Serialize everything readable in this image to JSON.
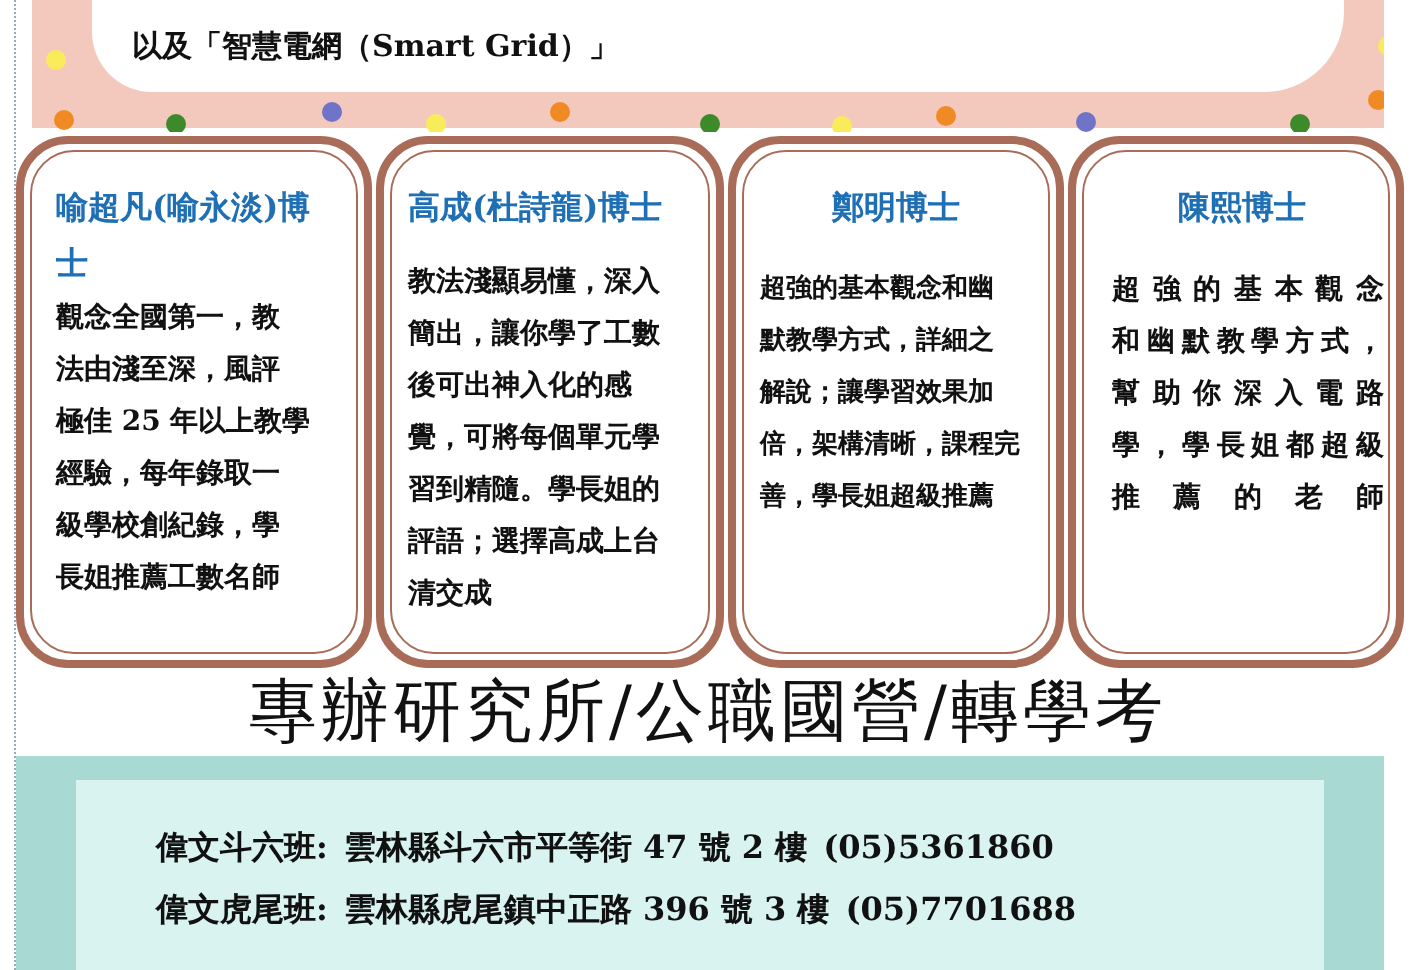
{
  "banner": {
    "text": "以及「智慧電網（Smart Grid）」"
  },
  "teachers": [
    {
      "name": "喻超凡(喻永淡)博士",
      "description": [
        "觀念全國第一，教",
        "法由淺至深，風評",
        "極佳 25 年以上教學",
        "經驗，每年錄取一",
        "級學校創紀錄，學",
        "長姐推薦工數名師"
      ]
    },
    {
      "name": "高成(杜詩龍)博士",
      "description": [
        "教法淺顯易懂，深入",
        "簡出，讓你學了工數",
        "後可出神入化的感",
        "覺，可將每個單元學",
        "習到精隨。學長姐的",
        "評語；選擇高成上台",
        "清交成"
      ]
    },
    {
      "name": "鄭明博士",
      "description": [
        "超強的基本觀念和幽",
        "默教學方式，詳細之",
        "解說；讓學習效果加",
        "倍，架構清晰，課程完",
        "善，學長姐超級推薦"
      ]
    },
    {
      "name": "陳熙博士",
      "description": [
        "超強的基本觀念",
        "和幽默教學方式，",
        "幫助你深入電路",
        "學，學長姐都超級",
        "推薦的老師"
      ]
    }
  ],
  "headline": "專辦研究所/公職國營/轉學考",
  "branches": [
    {
      "name": "偉文斗六班:",
      "address": "雲林縣斗六市平等街 47 號 2 樓",
      "phone": "(05)5361860"
    },
    {
      "name": "偉文虎尾班:",
      "address": "雲林縣虎尾鎮中正路 396 號 3 樓",
      "phone": "(05)7701688"
    }
  ]
}
